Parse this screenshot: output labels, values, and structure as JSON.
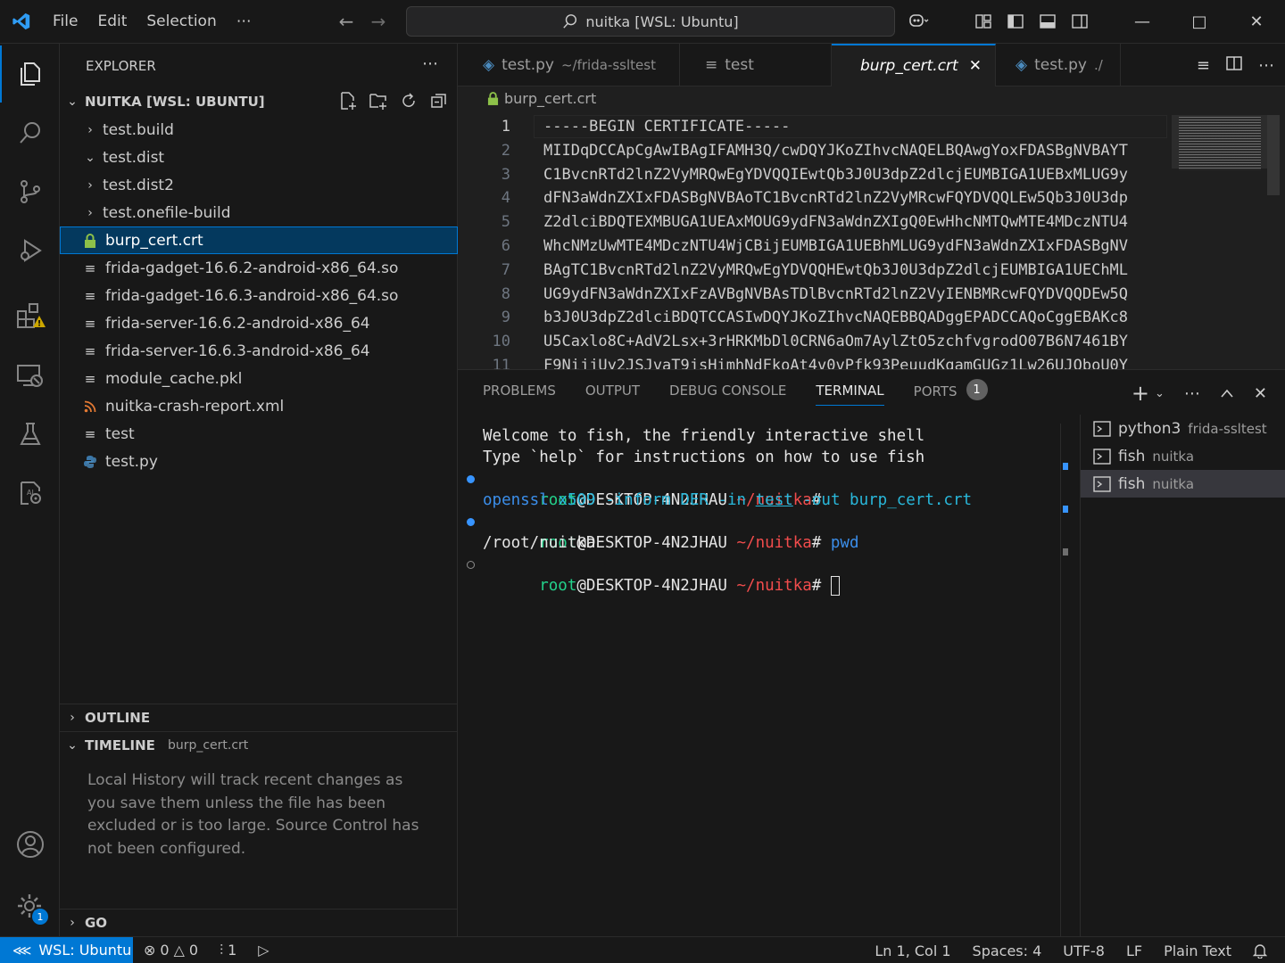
{
  "window": {
    "title": "nuitka [WSL: Ubuntu]",
    "menu": [
      "File",
      "Edit",
      "Selection",
      "⋯"
    ]
  },
  "explorer": {
    "header": "EXPLORER",
    "folder": "NUITKA [WSL: UBUNTU]",
    "items": [
      {
        "label": "test.build",
        "type": "folder-collapsed"
      },
      {
        "label": "test.dist",
        "type": "folder-expanded"
      },
      {
        "label": "test.dist2",
        "type": "folder-collapsed"
      },
      {
        "label": "test.onefile-build",
        "type": "folder-collapsed"
      },
      {
        "label": "burp_cert.crt",
        "type": "lock-file",
        "selected": true
      },
      {
        "label": "frida-gadget-16.6.2-android-x86_64.so",
        "type": "lines-file"
      },
      {
        "label": "frida-gadget-16.6.3-android-x86_64.so",
        "type": "lines-file"
      },
      {
        "label": "frida-server-16.6.2-android-x86_64",
        "type": "lines-file"
      },
      {
        "label": "frida-server-16.6.3-android-x86_64",
        "type": "lines-file"
      },
      {
        "label": "module_cache.pkl",
        "type": "lines-file"
      },
      {
        "label": "nuitka-crash-report.xml",
        "type": "rss-file"
      },
      {
        "label": "test",
        "type": "lines-file"
      },
      {
        "label": "test.py",
        "type": "python-file"
      }
    ],
    "outline": "OUTLINE",
    "timeline": {
      "label": "TIMELINE",
      "file": "burp_cert.crt",
      "message": "Local History will track recent changes as you save them unless the file has been excluded or is too large. Source Control has not been configured."
    },
    "go": "GO"
  },
  "editor": {
    "tabs": [
      {
        "label": "test.py",
        "desc": "~/frida-ssltest",
        "icon": "python-icon",
        "active": false
      },
      {
        "label": "test",
        "desc": "",
        "icon": "lines-icon",
        "active": false
      },
      {
        "label": "burp_cert.crt",
        "desc": "",
        "icon": "lock-icon",
        "active": true
      },
      {
        "label": "test.py",
        "desc": "./",
        "icon": "python-icon",
        "active": false
      }
    ],
    "breadcrumb": "burp_cert.crt",
    "lines": [
      {
        "n": "1",
        "text": "-----BEGIN CERTIFICATE-----"
      },
      {
        "n": "2",
        "text": "MIIDqDCCApCgAwIBAgIFAMH3Q/cwDQYJKoZIhvcNAQELBQAwgYoxFDASBgNVBAYT"
      },
      {
        "n": "3",
        "text": "C1BvcnRTd2lnZ2VyMRQwEgYDVQQIEwtQb3J0U3dpZ2dlcjEUMBIGA1UEBxMLUG9y"
      },
      {
        "n": "4",
        "text": "dFN3aWdnZXIxFDASBgNVBAoTC1BvcnRTd2lnZ2VyMRcwFQYDVQQLEw5Qb3J0U3dp"
      },
      {
        "n": "5",
        "text": "Z2dlciBDQTEXMBUGA1UEAxMOUG9ydFN3aWdnZXIgQ0EwHhcNMTQwMTE4MDczNTU4"
      },
      {
        "n": "6",
        "text": "WhcNMzUwMTE4MDczNTU4WjCBijEUMBIGA1UEBhMLUG9ydFN3aWdnZXIxFDASBgNV"
      },
      {
        "n": "7",
        "text": "BAgTC1BvcnRTd2lnZ2VyMRQwEgYDVQQHEwtQb3J0U3dpZ2dlcjEUMBIGA1UEChML"
      },
      {
        "n": "8",
        "text": "UG9ydFN3aWdnZXIxFzAVBgNVBAsTDlBvcnRTd2lnZ2VyIENBMRcwFQYDVQQDEw5Q"
      },
      {
        "n": "9",
        "text": "b3J0U3dpZ2dlciBDQTCCASIwDQYJKoZIhvcNAQEBBQADggEPADCCAQoCggEBAKc8"
      },
      {
        "n": "10",
        "text": "U5Caxlo8C+AdV2Lsx+3rHRKMbDl0CRN6aOm7AylZtO5zchfvgrodO07B6N7461BY"
      },
      {
        "n": "11",
        "text": "F9NijjUy2JSJvaT9jsHimhNdFkoAt4v0vPfk93PeuudKgamGUGz1Lw26UJQboU0Y"
      }
    ]
  },
  "panel": {
    "tabs": [
      "PROBLEMS",
      "OUTPUT",
      "DEBUG CONSOLE",
      "TERMINAL",
      "PORTS"
    ],
    "active_tab": "TERMINAL",
    "ports_count": "1",
    "terminal": {
      "welcome1": "Welcome to fish, the friendly interactive shell",
      "welcome2": "Type `help` for instructions on how to use fish",
      "user": "root",
      "host": "@DESKTOP-4N2JHAU",
      "cwd": "~/nuitka",
      "prompt_char": "#",
      "cmd1": {
        "prog": "openssl",
        "sub": "x509",
        "a1": "-inform",
        "a2": "DER",
        "a3": "-in",
        "a4": "test",
        "a5": "-out",
        "a6": "burp_cert.crt"
      },
      "cmd2": "pwd",
      "output2": "/root/nuitka"
    },
    "terminals": [
      {
        "name": "python3",
        "sub": "frida-ssltest"
      },
      {
        "name": "fish",
        "sub": "nuitka"
      },
      {
        "name": "fish",
        "sub": "nuitka",
        "selected": true
      }
    ]
  },
  "status": {
    "remote": "WSL: Ubuntu",
    "errors": "0",
    "warnings": "0",
    "ports": "1",
    "position": "Ln 1, Col 1",
    "spaces": "Spaces: 4",
    "encoding": "UTF-8",
    "eol": "LF",
    "language": "Plain Text",
    "settings_badge": "1"
  }
}
